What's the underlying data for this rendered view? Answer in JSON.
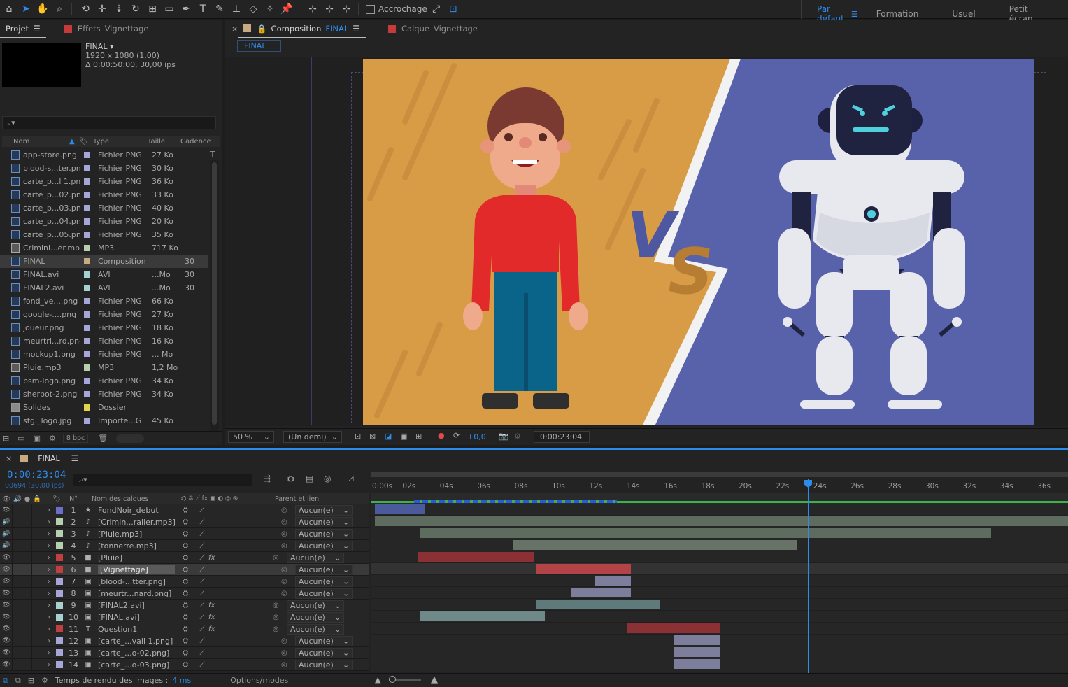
{
  "toolbar": {
    "snap_label": "Accrochage",
    "workspaces": [
      "Par défaut",
      "Formation",
      "Usuel",
      "Petit écran"
    ]
  },
  "project": {
    "tabs": [
      "Projet",
      "Effets",
      "Vignettage"
    ],
    "comp_name": "FINAL",
    "comp_res": "1920 x 1080 (1,00)",
    "comp_dur": "Δ 0:00:50:00, 30,00 ips",
    "search_placeholder": "⌕▾",
    "headers": {
      "name": "Nom",
      "type": "Type",
      "size": "Taille",
      "rate": "Cadence"
    },
    "items": [
      {
        "name": "app-store.png",
        "type": "Fichier PNG",
        "size": "27 Ko",
        "rate": "",
        "color": "#a7a6d8"
      },
      {
        "name": "blood-s...ter.png",
        "type": "Fichier PNG",
        "size": "30 Ko",
        "rate": "",
        "color": "#a7a6d8"
      },
      {
        "name": "carte_p...l 1.png",
        "type": "Fichier PNG",
        "size": "36 Ko",
        "rate": "",
        "color": "#a7a6d8"
      },
      {
        "name": "carte_p...02.png",
        "type": "Fichier PNG",
        "size": "33 Ko",
        "rate": "",
        "color": "#a7a6d8"
      },
      {
        "name": "carte_p...03.png",
        "type": "Fichier PNG",
        "size": "40 Ko",
        "rate": "",
        "color": "#a7a6d8"
      },
      {
        "name": "carte_p...04.png",
        "type": "Fichier PNG",
        "size": "20 Ko",
        "rate": "",
        "color": "#a7a6d8"
      },
      {
        "name": "carte_p...05.png",
        "type": "Fichier PNG",
        "size": "35 Ko",
        "rate": "",
        "color": "#a7a6d8"
      },
      {
        "name": "Crimini...er.mp3",
        "type": "MP3",
        "size": "717 Ko",
        "rate": "",
        "color": "#b6cfae"
      },
      {
        "name": "FINAL",
        "type": "Composition",
        "size": "",
        "rate": "30",
        "color": "#c7a982"
      },
      {
        "name": "FINAL.avi",
        "type": "AVI",
        "size": "...Mo",
        "rate": "30",
        "color": "#a7d0d0"
      },
      {
        "name": "FINAL2.avi",
        "type": "AVI",
        "size": "...Mo",
        "rate": "30",
        "color": "#a7d0d0"
      },
      {
        "name": "fond_ve....png",
        "type": "Fichier PNG",
        "size": "66 Ko",
        "rate": "",
        "color": "#a7a6d8"
      },
      {
        "name": "google-....png",
        "type": "Fichier PNG",
        "size": "27 Ko",
        "rate": "",
        "color": "#a7a6d8"
      },
      {
        "name": "joueur.png",
        "type": "Fichier PNG",
        "size": "18 Ko",
        "rate": "",
        "color": "#a7a6d8"
      },
      {
        "name": "meurtri...rd.png",
        "type": "Fichier PNG",
        "size": "16 Ko",
        "rate": "",
        "color": "#a7a6d8"
      },
      {
        "name": "mockup1.png",
        "type": "Fichier PNG",
        "size": "... Mo",
        "rate": "",
        "color": "#a7a6d8"
      },
      {
        "name": "Pluie.mp3",
        "type": "MP3",
        "size": "1,2 Mo",
        "rate": "",
        "color": "#b6cfae"
      },
      {
        "name": "psm-logo.png",
        "type": "Fichier PNG",
        "size": "34 Ko",
        "rate": "",
        "color": "#a7a6d8"
      },
      {
        "name": "sherbot-2.png",
        "type": "Fichier PNG",
        "size": "34 Ko",
        "rate": "",
        "color": "#a7a6d8"
      },
      {
        "name": "Solides",
        "type": "Dossier",
        "size": "",
        "rate": "",
        "color": "#e3d24f"
      },
      {
        "name": "stgi_logo.jpg",
        "type": "Importe...G",
        "size": "45 Ko",
        "rate": "",
        "color": "#a7a6d8"
      }
    ],
    "bpc": "8 bpc"
  },
  "comp": {
    "tab_label": "Composition",
    "tab_name": "FINAL",
    "layer_tab_label": "Calque",
    "layer_tab_name": "Vignettage",
    "sub_tab": "FINAL",
    "zoom": "50 %",
    "resolution": "(Un demi)",
    "exposure": "+0,0",
    "timecode": "0:00:23:04",
    "vs_v": "V",
    "vs_s": "S"
  },
  "timeline": {
    "comp_tab": "FINAL",
    "timecode": "0:00:23:04",
    "frames": "00694 (30,00 ips)",
    "search_placeholder": "⌕▾",
    "ruler": [
      "0:00s",
      "02s",
      "04s",
      "06s",
      "08s",
      "10s",
      "12s",
      "14s",
      "16s",
      "18s",
      "20s",
      "22s",
      "24s",
      "26s",
      "28s",
      "30s",
      "32s",
      "34s",
      "36s"
    ],
    "headers": {
      "num": "N°",
      "name": "Nom des calques",
      "parent": "Parent et lien"
    },
    "layers": [
      {
        "num": "1",
        "name": "FondNoir_debut",
        "icon": "★",
        "color": "#6c6fc8",
        "eye": "👁",
        "fx": "",
        "bar": [
          0,
          2.7
        ],
        "barcolor": "#4a5a9a"
      },
      {
        "num": "2",
        "name": "[Crimin...railer.mp3]",
        "icon": "♪",
        "color": "#b6cfae",
        "eye": "🔊",
        "fx": "",
        "bar": [
          0,
          37.5
        ],
        "barcolor": "#5e6b5f"
      },
      {
        "num": "3",
        "name": "[Pluie.mp3]",
        "icon": "♪",
        "color": "#b6cfae",
        "eye": "🔊",
        "fx": "",
        "bar": [
          2.4,
          33
        ],
        "barcolor": "#5e6b5f"
      },
      {
        "num": "4",
        "name": "[tonnerre.mp3]",
        "icon": "♪",
        "color": "#b6cfae",
        "eye": "🔊",
        "fx": "",
        "bar": [
          7.4,
          22.6
        ],
        "barcolor": "#667366"
      },
      {
        "num": "5",
        "name": "[Pluie]",
        "icon": "■",
        "color": "#c04040",
        "eye": "👁",
        "fx": "fx",
        "bar": [
          2.3,
          8.5
        ],
        "barcolor": "#8b3136"
      },
      {
        "num": "6",
        "name": "[Vignettage]",
        "icon": "■",
        "color": "#c04040",
        "eye": "👁",
        "fx": "",
        "bar": [
          8.6,
          13.7
        ],
        "barcolor": "#b24448"
      },
      {
        "num": "7",
        "name": "[blood-...tter.png]",
        "icon": "▣",
        "color": "#a7a6d8",
        "eye": "👁",
        "fx": "",
        "bar": [
          11.8,
          13.7
        ],
        "barcolor": "#7d7d9c"
      },
      {
        "num": "8",
        "name": "[meurtr...nard.png]",
        "icon": "▣",
        "color": "#a7a6d8",
        "eye": "👁",
        "fx": "",
        "bar": [
          10.5,
          13.7
        ],
        "barcolor": "#7d7d9c"
      },
      {
        "num": "9",
        "name": "[FINAL2.avi]",
        "icon": "▣",
        "color": "#a7d0d0",
        "eye": "👁",
        "fx": "fx",
        "bar": [
          8.6,
          15.3
        ],
        "barcolor": "#5f7a7a"
      },
      {
        "num": "10",
        "name": "[FINAL.avi]",
        "icon": "▣",
        "color": "#a7d0d0",
        "eye": "👁",
        "fx": "fx",
        "bar": [
          2.4,
          9.1
        ],
        "barcolor": "#6f8888"
      },
      {
        "num": "11",
        "name": "Question1",
        "icon": "T",
        "color": "#c04040",
        "eye": "👁",
        "fx": "fx",
        "bar": [
          13.5,
          18.5
        ],
        "barcolor": "#8b3136"
      },
      {
        "num": "12",
        "name": "[carte_...vail 1.png]",
        "icon": "▣",
        "color": "#a7a6d8",
        "eye": "👁",
        "fx": "",
        "bar": [
          16,
          18.5
        ],
        "barcolor": "#7d7d9c"
      },
      {
        "num": "13",
        "name": "[carte_...o-02.png]",
        "icon": "▣",
        "color": "#a7a6d8",
        "eye": "👁",
        "fx": "",
        "bar": [
          16,
          18.5
        ],
        "barcolor": "#7d7d9c"
      },
      {
        "num": "14",
        "name": "[carte_...o-03.png]",
        "icon": "▣",
        "color": "#a7a6d8",
        "eye": "👁",
        "fx": "",
        "bar": [
          16,
          18.5
        ],
        "barcolor": "#7d7d9c"
      }
    ],
    "parent_value": "Aucun(e)",
    "footer_render_label": "Temps de rendu des images :",
    "footer_render_value": "4 ms",
    "footer_modes": "Options/modes"
  }
}
